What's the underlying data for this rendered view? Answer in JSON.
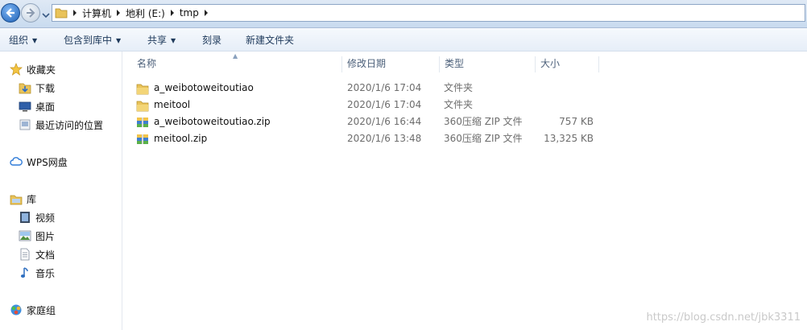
{
  "address": {
    "crumbs": [
      "计算机",
      "地利 (E:)",
      "tmp"
    ]
  },
  "toolbar": {
    "organize": "组织",
    "include_in_library": "包含到库中",
    "share": "共享",
    "burn": "刻录",
    "new_folder": "新建文件夹"
  },
  "nav": {
    "favorites": "收藏夹",
    "downloads": "下载",
    "desktop": "桌面",
    "recent": "最近访问的位置",
    "wps_cloud": "WPS网盘",
    "libraries": "库",
    "videos": "视频",
    "pictures": "图片",
    "documents": "文档",
    "music": "音乐",
    "homegroup": "家庭组"
  },
  "columns": {
    "name": "名称",
    "modified": "修改日期",
    "type": "类型",
    "size": "大小"
  },
  "files": [
    {
      "name": "a_weibotoweitoutiao",
      "modified": "2020/1/6 17:04",
      "type": "文件夹",
      "size": "",
      "icon": "folder-icon"
    },
    {
      "name": "meitool",
      "modified": "2020/1/6 17:04",
      "type": "文件夹",
      "size": "",
      "icon": "folder-icon"
    },
    {
      "name": "a_weibotoweitoutiao.zip",
      "modified": "2020/1/6 16:44",
      "type": "360压缩 ZIP 文件",
      "size": "757 KB",
      "icon": "zip-archive-icon"
    },
    {
      "name": "meitool.zip",
      "modified": "2020/1/6 13:48",
      "type": "360压缩 ZIP 文件",
      "size": "13,325 KB",
      "icon": "zip-archive-icon"
    }
  ],
  "watermark": "https://blog.csdn.net/jbk3311"
}
